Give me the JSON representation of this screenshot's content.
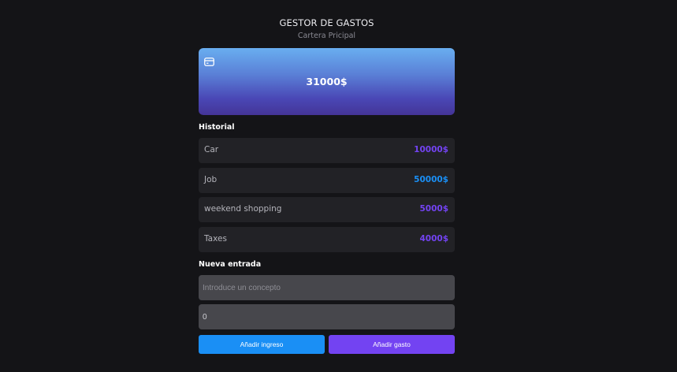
{
  "header": {
    "title": "GESTOR DE GASTOS",
    "subtitle": "Cartera Pricipal"
  },
  "card": {
    "icon": "credit-card-icon",
    "balance": "31000$"
  },
  "history": {
    "label": "Historial",
    "items": [
      {
        "concept": "Car",
        "amount": "10000$",
        "type": "expense"
      },
      {
        "concept": "Job",
        "amount": "50000$",
        "type": "income"
      },
      {
        "concept": "weekend shopping",
        "amount": "5000$",
        "type": "expense"
      },
      {
        "concept": "Taxes",
        "amount": "4000$",
        "type": "expense"
      }
    ]
  },
  "new_entry": {
    "label": "Nueva entrada",
    "concept_placeholder": "Introduce un concepto",
    "concept_value": "",
    "amount_value": "0",
    "income_button": "Añadir ingreso",
    "expense_button": "Añadir gasto"
  },
  "colors": {
    "income": "#1a8ff5",
    "expense": "#7343f2",
    "background": "#141417",
    "row": "#222226",
    "field": "#47474c"
  }
}
